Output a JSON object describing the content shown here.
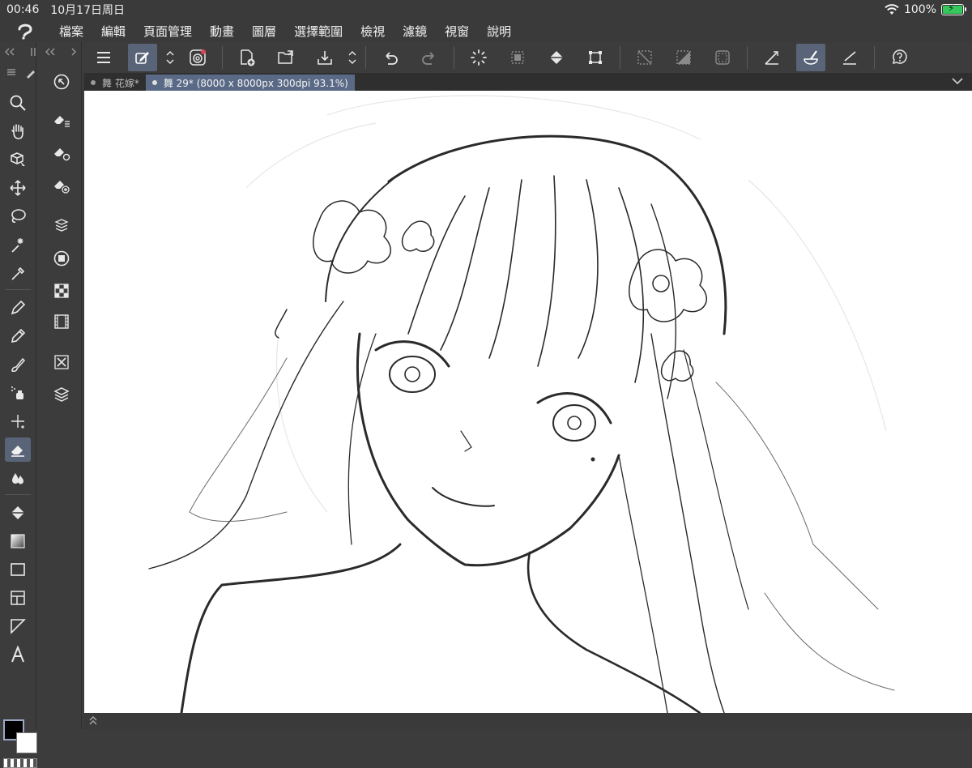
{
  "status": {
    "time": "00:46",
    "date": "10月17日周日",
    "battery": "100%"
  },
  "menu": [
    "檔案",
    "編輯",
    "頁面管理",
    "動畫",
    "圖層",
    "選擇範圍",
    "檢視",
    "濾鏡",
    "視窗",
    "說明"
  ],
  "tabs": [
    {
      "label": "舞 花嫁*",
      "active": false
    },
    {
      "label": "舞 29* (8000 x 8000px 300dpi 93.1%)",
      "active": true
    }
  ],
  "toolbar_icons": [
    "menu-icon",
    "edit-mode-icon",
    "updown-icon",
    "companion-icon",
    "new-page-icon",
    "open-icon",
    "save-icon",
    "updown-icon",
    "undo-icon",
    "redo-icon",
    "spinner-icon",
    "transform-icon",
    "fill-icon",
    "scale-icon",
    "deselect-icon",
    "invert-icon",
    "border-icon",
    "ruler-icon",
    "brush-icon",
    "line-icon",
    "help-icon"
  ],
  "colors": {
    "accent": "#5a6478",
    "tab_active": "#5a6a86",
    "bg": "#3c3c3c",
    "battery": "#34c759"
  }
}
